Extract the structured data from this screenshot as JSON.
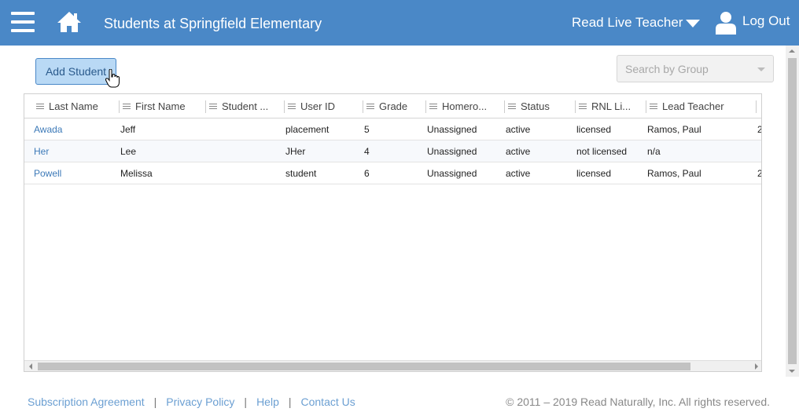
{
  "header": {
    "title": "Students at Springfield Elementary",
    "teacher_menu": "Read Live Teacher",
    "logout": "Log Out"
  },
  "toolbar": {
    "add_student": "Add Student",
    "group_placeholder": "Search by Group"
  },
  "grid": {
    "columns": [
      "Last Name",
      "First Name",
      "Student ...",
      "User ID",
      "Grade",
      "Homero...",
      "Status",
      "RNL Li...",
      "Lead Teacher"
    ],
    "rows": [
      [
        "Awada",
        "Jeff",
        "",
        "placement",
        "5",
        "Unassigned",
        "active",
        "licensed",
        "Ramos, Paul",
        "2"
      ],
      [
        "Her",
        "Lee",
        "",
        "JHer",
        "4",
        "Unassigned",
        "active",
        "not licensed",
        "n/a",
        ""
      ],
      [
        "Powell",
        "Melissa",
        "",
        "student",
        "6",
        "Unassigned",
        "active",
        "licensed",
        "Ramos, Paul",
        "2"
      ]
    ]
  },
  "footer": {
    "links": [
      "Subscription Agreement",
      "Privacy Policy",
      "Help",
      "Contact Us"
    ],
    "separator": "|",
    "copyright": "© 2011 – 2019 Read Naturally, Inc. All rights reserved."
  },
  "colors": {
    "header_bg": "#4a88c7",
    "link": "#3d7ab8",
    "button_bg": "#b9d9f5"
  }
}
